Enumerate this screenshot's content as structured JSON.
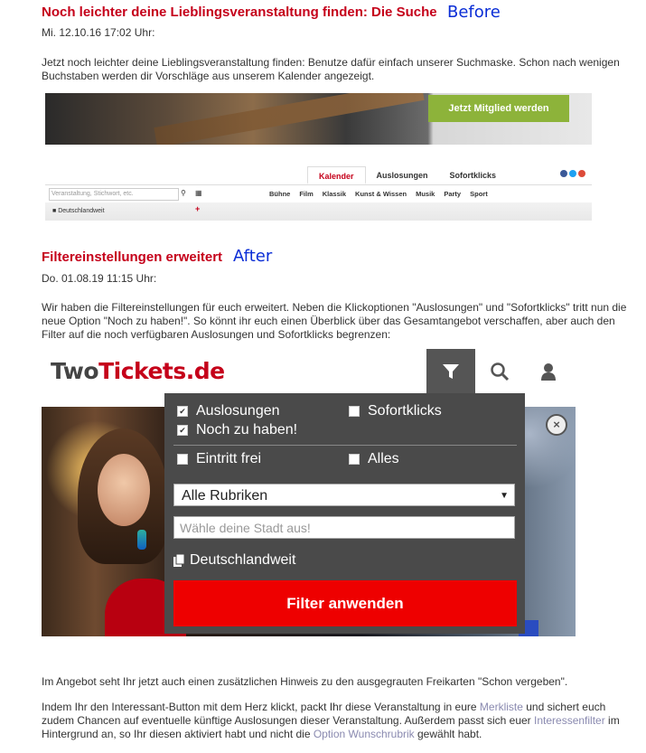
{
  "section_before": {
    "title": "Noch leichter deine Lieblingsveranstaltung finden: Die Suche",
    "tag": "Before",
    "date": "Mi. 12.10.16 17:02 Uhr:",
    "body": "Jetzt noch leichter deine Lieblingsveranstaltung finden: Benutze dafür einfach unserer Suchmaske. Schon nach wenigen Buchstaben werden dir Vorschläge aus unserem Kalender angezeigt."
  },
  "old_ui": {
    "member_button": "Jetzt Mitglied werden",
    "tabs": [
      "Kalender",
      "Auslosungen",
      "Sofortklicks"
    ],
    "search_placeholder": "Veranstaltung, Stichwort, etc.",
    "categories": [
      "Bühne",
      "Film",
      "Klassik",
      "Kunst & Wissen",
      "Musik",
      "Party",
      "Sport"
    ],
    "location": "Deutschlandweit",
    "social_colors": [
      "#3b5998",
      "#1da1f2",
      "#dd4b39"
    ]
  },
  "section_after": {
    "title": "Filtereinstellungen erweitert",
    "tag": "After",
    "date": "Do. 01.08.19 11:15 Uhr:",
    "body": "Wir haben die Filtereinstellungen für euch erweitert. Neben die Klickoptionen \"Auslosungen\" und \"Sofortklicks\" tritt nun die neue Option \"Noch zu haben!\". So könnt ihr euch einen Überblick über das Gesamtangebot verschaffen, aber auch den Filter auf die noch verfügbaren Auslosungen und Sofortklicks begrenzen:"
  },
  "new_ui": {
    "logo_part1": "Two",
    "logo_part2": "Tickets.de",
    "header_icons": [
      "filter-icon",
      "search-icon",
      "user-icon"
    ],
    "checkboxes": {
      "auslosungen": {
        "label": "Auslosungen",
        "checked": true
      },
      "sofortklicks": {
        "label": "Sofortklicks",
        "checked": false
      },
      "noch_zu_haben": {
        "label": "Noch zu haben!",
        "checked": true
      },
      "eintritt_frei": {
        "label": "Eintritt frei",
        "checked": false
      },
      "alles": {
        "label": "Alles",
        "checked": false
      }
    },
    "rubrik_select": "Alle Rubriken",
    "city_placeholder": "Wähle deine Stadt aus!",
    "location": "Deutschlandweit",
    "filter_button": "Filter anwenden",
    "close_symbol": "×",
    "accent_color": "#e00000"
  },
  "footer": {
    "p1": "Im Angebot seht Ihr jetzt auch einen zusätzlichen Hinweis zu den ausgegrauten Freikarten \"Schon vergeben\".",
    "p2_a": "Indem Ihr den Interessant-Button mit dem Herz klickt, packt Ihr diese Veranstaltung in eure ",
    "p2_link1": "Merkliste",
    "p2_b": " und sichert euch zudem Chancen auf eventuelle künftige Auslosungen dieser Veranstaltung. Außerdem passt sich euer ",
    "p2_link2": "Interessenfilter",
    "p2_c": " im Hintergrund an, so Ihr diesen aktiviert habt und nicht die ",
    "p2_link3": "Option Wunschrubrik",
    "p2_d": " gewählt habt."
  }
}
